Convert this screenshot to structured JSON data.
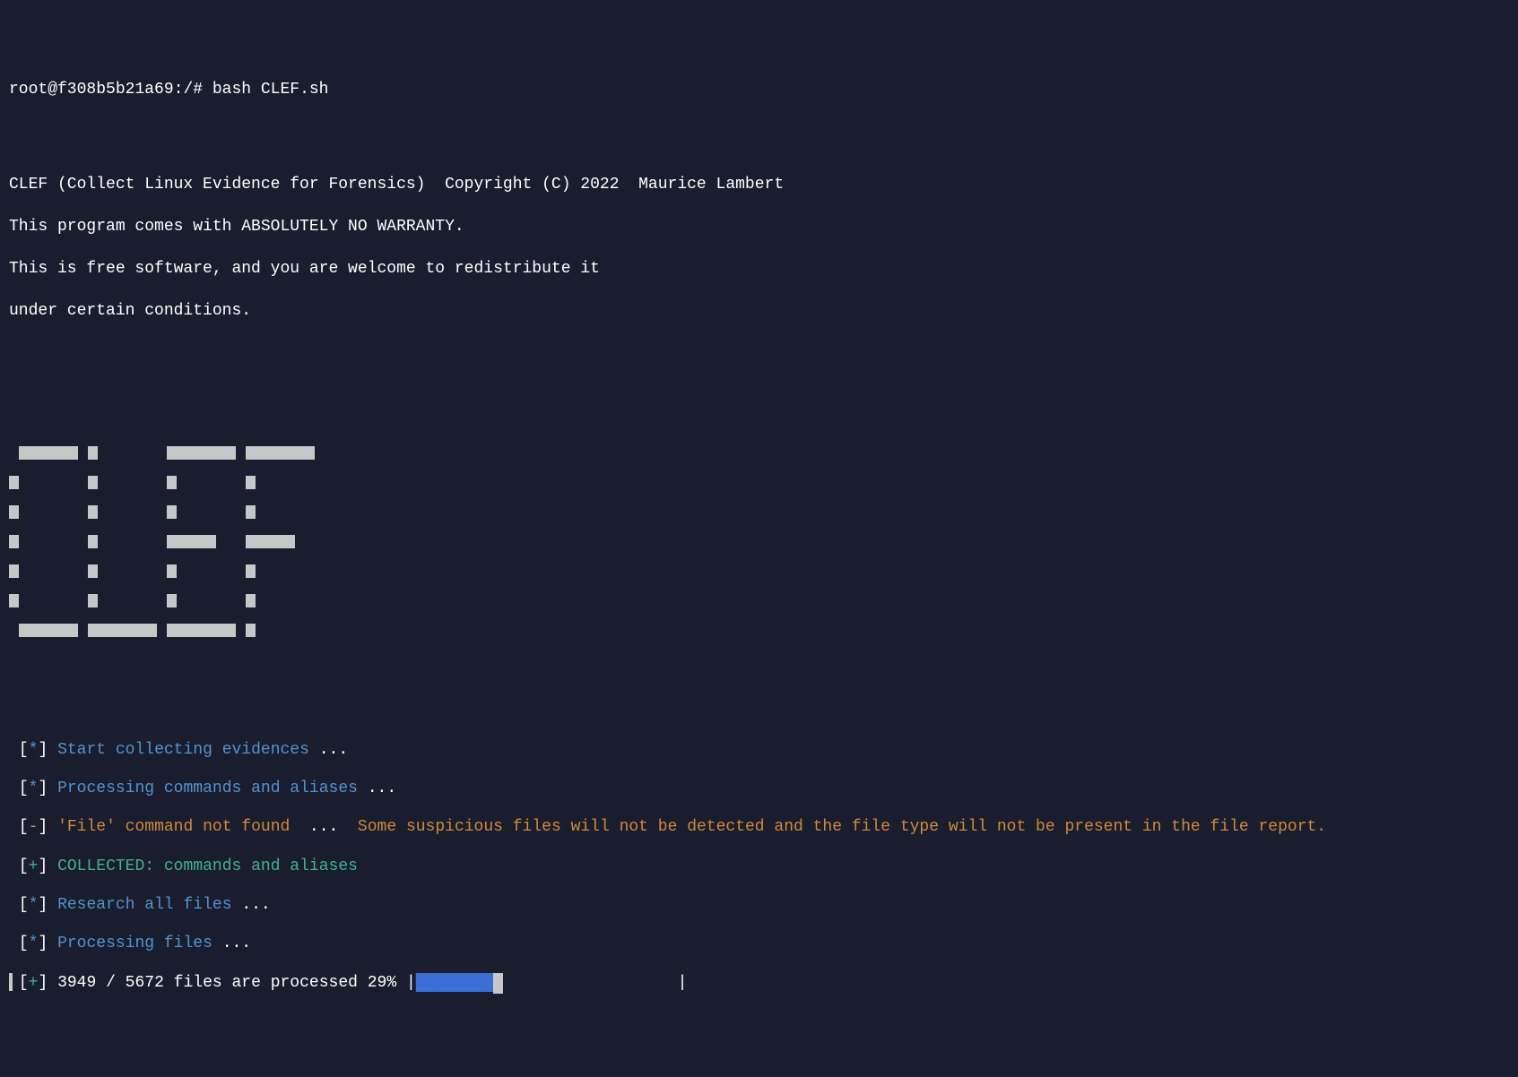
{
  "prompt": {
    "user_host": "root@f308b5b21a69",
    "path": ":/#",
    "command": "bash CLEF.sh"
  },
  "copyright": {
    "line1": "CLEF (Collect Linux Evidence for Forensics)  Copyright (C) 2022  Maurice Lambert",
    "line2": "This program comes with ABSOLUTELY NO WARRANTY.",
    "line3": "This is free software, and you are welcome to redistribute it",
    "line4": "under certain conditions."
  },
  "logs": {
    "line1": {
      "prefix": "[*]",
      "text": "Start collecting evidences",
      "dots": "..."
    },
    "line2": {
      "prefix": "[*]",
      "text": "Processing commands and aliases",
      "dots": "..."
    },
    "line3": {
      "prefix": "[-]",
      "text": "'File' command not found",
      "dots": "...",
      "detail": "  Some suspicious files will not be detected and the file type will not be present in the file report."
    },
    "line4": {
      "prefix": "[+]",
      "text": "COLLECTED: commands and aliases"
    },
    "line5": {
      "prefix": "[*]",
      "text": "Research all files",
      "dots": "..."
    },
    "line6": {
      "prefix": "[*]",
      "text": "Processing files",
      "dots": "..."
    },
    "line7": {
      "prefix": "[+]",
      "text": "3949 / 5672 files are processed 29% "
    }
  },
  "progress": {
    "current": 3949,
    "total": 5672,
    "percent": 29,
    "bar_filled": 8,
    "bar_total": 25
  }
}
